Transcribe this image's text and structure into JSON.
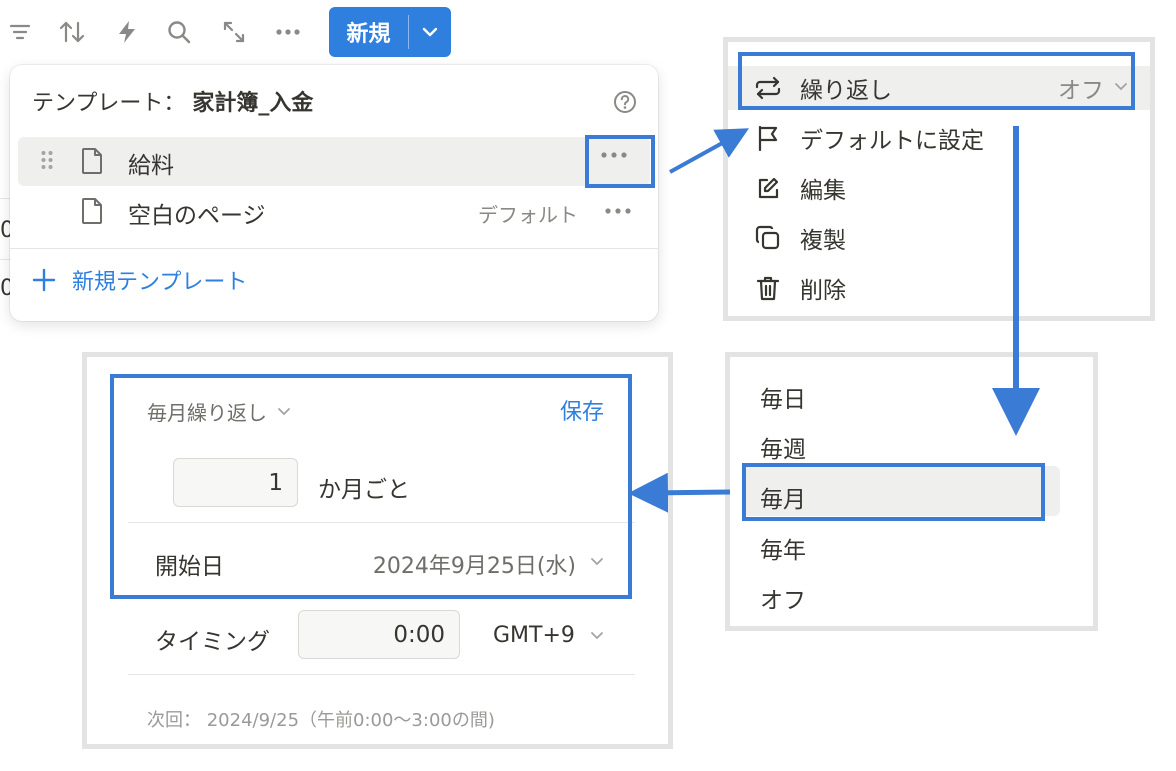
{
  "toolbar": {
    "icons": [
      "filter-icon",
      "sort-icon",
      "automation-icon",
      "search-icon",
      "expand-icon",
      "more-icon"
    ],
    "new_label": "新規"
  },
  "template_popup": {
    "title_prefix": "テンプレート：",
    "title_name": "家計簿_入金",
    "items": [
      {
        "label": "給料",
        "badge": ""
      },
      {
        "label": "空白のページ",
        "badge": "デフォルト"
      }
    ],
    "new_template_label": "新規テンプレート"
  },
  "context_menu": {
    "repeat_label": "繰り返し",
    "repeat_value": "オフ",
    "items": [
      "デフォルトに設定",
      "編集",
      "複製",
      "削除"
    ]
  },
  "repeat_options": [
    "毎日",
    "毎週",
    "毎月",
    "毎年",
    "オフ"
  ],
  "repeat_settings": {
    "mode_label": "毎月繰り返し",
    "save_label": "保存",
    "interval_value": "1",
    "interval_unit": "か月ごと",
    "start_label": "開始日",
    "start_value": "2024年9月25日(水)",
    "timing_label": "タイミング",
    "time_value": "0:00",
    "timezone": "GMT+9",
    "next_text": "次回： 2024/9/25（午前0:00〜3:00の間)"
  },
  "colors": {
    "accent": "#2f7fde",
    "highlight_border": "#3a7bd5",
    "arrow": "#3a7bd5"
  }
}
